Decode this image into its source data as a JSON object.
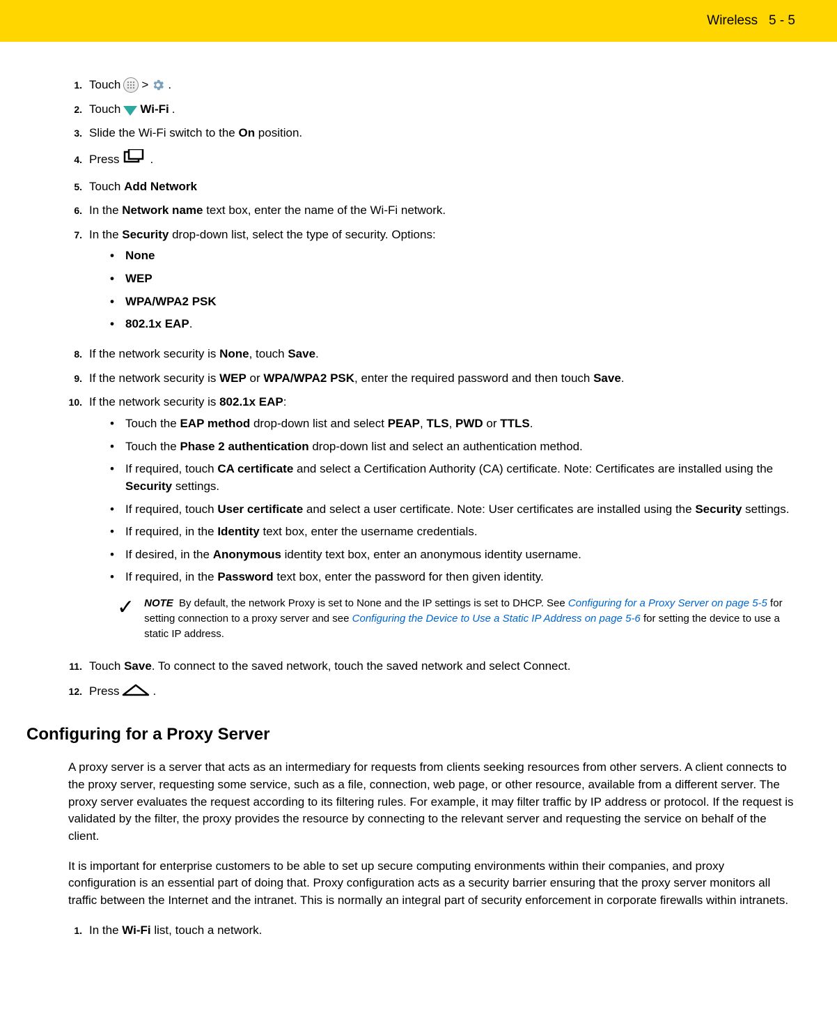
{
  "header": {
    "chapter": "Wireless",
    "page": "5 - 5"
  },
  "steps": {
    "s1_touch": "Touch",
    "s1_gt": ">",
    "s1_dot": ".",
    "s2_touch": "Touch",
    "s2_wifi": "Wi-Fi",
    "s2_dot": ".",
    "s3": "Slide the Wi-Fi switch to the ",
    "s3_on": "On",
    "s3_rest": " position.",
    "s4": "Press ",
    "s4_dot": ".",
    "s5": "Touch ",
    "s5_add": "Add Network",
    "s6_a": "In the ",
    "s6_b": "Network name",
    "s6_c": " text box, enter the name of the Wi-Fi network.",
    "s7_a": "In the ",
    "s7_b": "Security",
    "s7_c": " drop-down list, select the type of security. Options:",
    "opt_none": "None",
    "opt_wep": "WEP",
    "opt_wpa": "WPA/WPA2 PSK",
    "opt_eap": "802.1x EAP",
    "opt_eap_dot": ".",
    "s8_a": "If the network security is ",
    "s8_b": "None",
    "s8_c": ", touch ",
    "s8_d": "Save",
    "s8_e": ".",
    "s9_a": "If the network security is ",
    "s9_b": "WEP",
    "s9_c": " or ",
    "s9_d": "WPA/WPA2 PSK",
    "s9_e": ", enter the required password and then touch ",
    "s9_f": "Save",
    "s9_g": ".",
    "s10_a": "If the network security is ",
    "s10_b": "802.1x EAP",
    "s10_c": ":",
    "eap1_a": "Touch the ",
    "eap1_b": "EAP method",
    "eap1_c": " drop-down list and select ",
    "eap1_d": "PEAP",
    "eap1_e": ", ",
    "eap1_f": "TLS",
    "eap1_g": ", ",
    "eap1_h": "PWD",
    "eap1_i": " or ",
    "eap1_j": "TTLS",
    "eap1_k": ".",
    "eap2_a": "Touch the ",
    "eap2_b": "Phase 2 authentication",
    "eap2_c": " drop-down list and select an authentication method.",
    "eap3_a": "If required, touch ",
    "eap3_b": "CA certificate",
    "eap3_c": " and select a Certification Authority (CA) certificate. Note: Certificates are installed using the ",
    "eap3_d": "Security",
    "eap3_e": " settings.",
    "eap4_a": "If required, touch ",
    "eap4_b": "User certificate",
    "eap4_c": " and select a user certificate. Note: User certificates are installed using the ",
    "eap4_d": "Security",
    "eap4_e": " settings.",
    "eap5_a": "If required, in the ",
    "eap5_b": "Identity",
    "eap5_c": " text box, enter the username credentials.",
    "eap6_a": "If desired, in the ",
    "eap6_b": "Anonymous",
    "eap6_c": " identity text box, enter an anonymous identity username.",
    "eap7_a": "If required, in the ",
    "eap7_b": "Password",
    "eap7_c": " text box, enter the password for then given identity.",
    "note_label": "NOTE",
    "note_a": "By default, the network Proxy is set to None and the IP settings is set to DHCP. See ",
    "note_link1": "Configuring for a Proxy Server on page 5-5",
    "note_b": " for setting connection to a proxy server and see ",
    "note_link2": "Configuring the Device to Use a Static IP Address on page 5-6",
    "note_c": " for setting the device to use a static IP address.",
    "s11_a": "Touch ",
    "s11_b": "Save",
    "s11_c": ". To connect to the saved network, touch the saved network and select Connect.",
    "s12": "Press ",
    "s12_dot": "."
  },
  "section_heading": "Configuring for a Proxy Server",
  "para1": "A proxy server is a server that acts as an intermediary for requests from clients seeking resources from other servers. A client connects to the proxy server, requesting some service, such as a file, connection, web page, or other resource, available from a different server. The proxy server evaluates the request according to its filtering rules. For example, it may filter traffic by IP address or protocol. If the request is validated by the filter, the proxy provides the resource by connecting to the relevant server and requesting the service on behalf of the client.",
  "para2": "It is important for enterprise customers to be able to set up secure computing environments within their companies, and proxy configuration is an essential part of doing that. Proxy configuration acts as a security barrier ensuring that the proxy server monitors all traffic between the Internet and the intranet. This is normally an integral part of security enforcement in corporate firewalls within intranets.",
  "proxy_step1_a": "In the ",
  "proxy_step1_b": "Wi-Fi",
  "proxy_step1_c": " list, touch a network."
}
